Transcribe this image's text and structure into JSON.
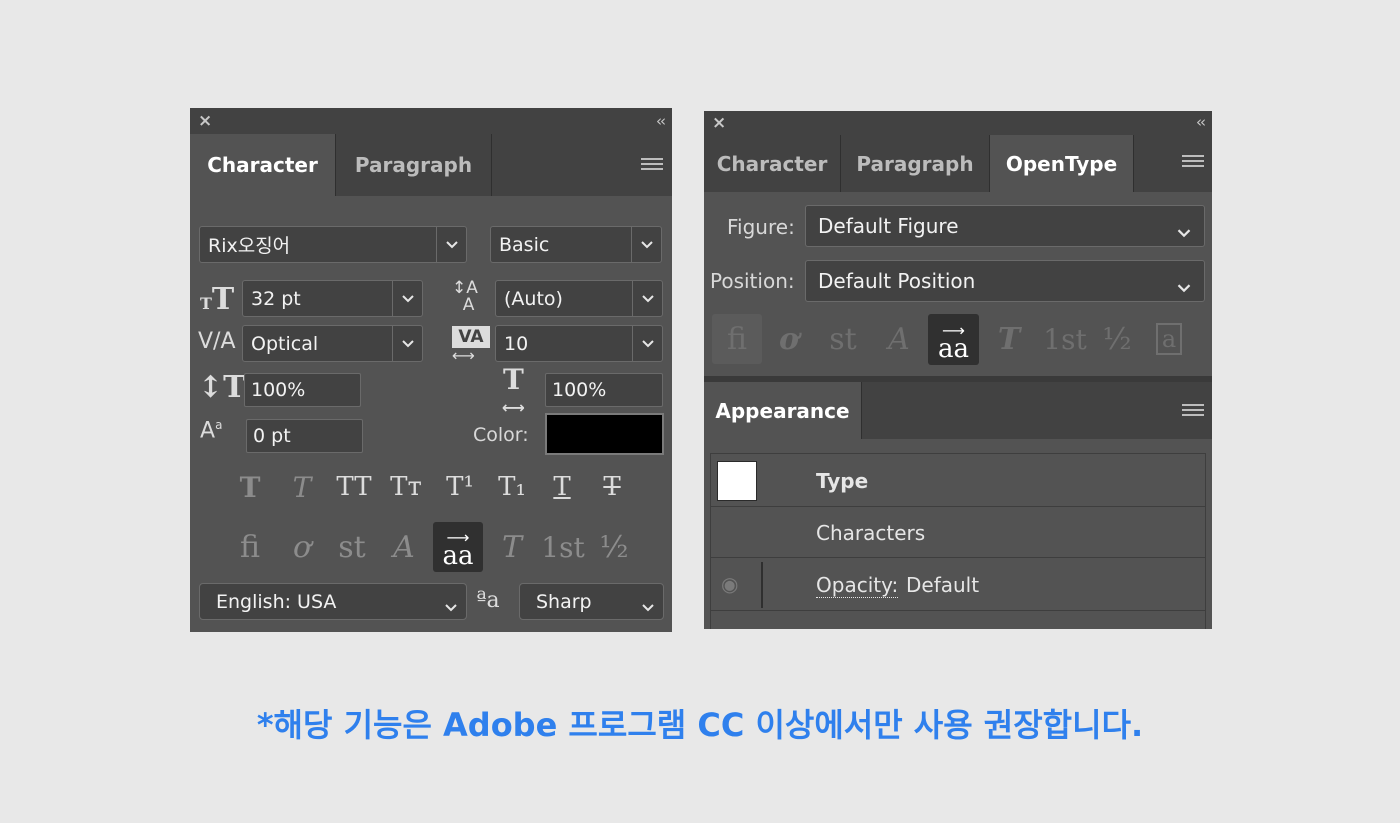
{
  "left_panel": {
    "close_icon": "×",
    "collapse_icon": "‹‹",
    "tabs": [
      {
        "label": "Character"
      },
      {
        "label": "Paragraph"
      }
    ],
    "font_family": "Rix오징어",
    "font_style": "Basic",
    "font_size": "32 pt",
    "leading": "(Auto)",
    "kerning": "Optical",
    "tracking": "10",
    "vertical_scale": "100%",
    "horizontal_scale": "100%",
    "baseline_shift": "0 pt",
    "color_label": "Color:",
    "color_value": "#000000",
    "style_buttons": [
      "T",
      "T",
      "TT",
      "Tт",
      "T¹",
      "T₁",
      "T",
      "T"
    ],
    "opentype_buttons": [
      "ﬁ",
      "ơ",
      "st",
      "A",
      "aa",
      "T",
      "1st",
      "½"
    ],
    "language": "English: USA",
    "antialias_icon": "ªa",
    "antialias": "Sharp"
  },
  "right_panel": {
    "close_icon": "×",
    "collapse_icon": "‹‹",
    "tabs": [
      {
        "label": "Character"
      },
      {
        "label": "Paragraph"
      },
      {
        "label": "OpenType"
      }
    ],
    "figure_label": "Figure:",
    "figure_value": "Default Figure",
    "position_label": "Position:",
    "position_value": "Default Position",
    "opentype_buttons": [
      "fi",
      "ơ",
      "st",
      "A",
      "aa",
      "T",
      "1st",
      "½",
      "a"
    ],
    "appearance_tab": "Appearance",
    "appearance": {
      "type_label": "Type",
      "characters_label": "Characters",
      "opacity_label": "Opacity:",
      "opacity_value": "Default"
    }
  },
  "footer_text": "*해당 기능은 Adobe 프로그램 CC 이상에서만 사용 권장합니다.",
  "colors": {
    "accent": "#2f80ed",
    "panel_bg": "#535353",
    "dark_bg": "#424242"
  }
}
